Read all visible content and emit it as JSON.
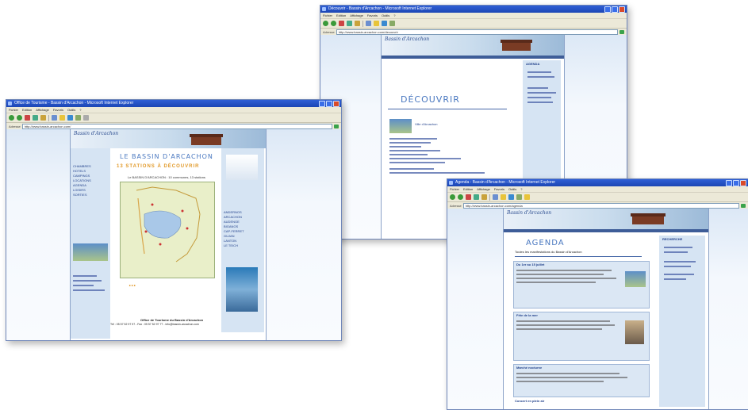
{
  "window_left": {
    "title": "Office de Tourisme - Bassin d'Arcachon - Microsoft Internet Explorer",
    "menu": [
      "Fichier",
      "Edition",
      "Affichage",
      "Favoris",
      "Outils",
      "?"
    ],
    "address": "http://www.bassin-arcachon.com/",
    "site_logo": "Bassin d'Arcachon",
    "headline": "LE BASSIN D'ARCACHON",
    "subheadline": "13 STATIONS À DÉCOUVRIR",
    "map_caption": "Le BASSIN D'ARCACHON : 10 communes, 13 stations",
    "sidebar_links": [
      "CHAMBRES",
      "HOTELS",
      "CAMPINGS",
      "LOCATIONS",
      "AGENDA",
      "LOISIRS",
      "SORTIES"
    ],
    "right_links": [
      "ANDERNOS",
      "ARCACHON",
      "AUDENGE",
      "BIGANOS",
      "CAP-FERRET",
      "GUJAN",
      "LANTON",
      "LE TEICH"
    ],
    "footer_line1": "Office de Tourisme du Bassin d'Arcachon",
    "footer_line2": "Tél : 05 57 52 97 97 - Fax : 05 57 52 97 77 - info@bassin-arcachon.com"
  },
  "window_top": {
    "title": "Découvrir - Bassin d'Arcachon - Microsoft Internet Explorer",
    "menu": [
      "Fichier",
      "Edition",
      "Affichage",
      "Favoris",
      "Outils",
      "?"
    ],
    "address": "http://www.bassin-arcachon.com/decouvrir",
    "site_logo": "Bassin d'Arcachon",
    "heading": "DÉCOUVRIR",
    "item_label": "Ville d'Arcachon",
    "sidebar_title": "AGENDA"
  },
  "window_right": {
    "title": "Agenda - Bassin d'Arcachon - Microsoft Internet Explorer",
    "menu": [
      "Fichier",
      "Edition",
      "Affichage",
      "Favoris",
      "Outils",
      "?"
    ],
    "address": "http://www.bassin-arcachon.com/agenda",
    "site_logo": "Bassin d'Arcachon",
    "heading": "AGENDA",
    "subheading": "Toutes les manifestations du Bassin d'Arcachon",
    "sidebar_title": "RECHERCHE",
    "events": [
      "Du 1er au 15 juillet",
      "Fête de la mer",
      "Marché nocturne",
      "Concert en plein air"
    ]
  }
}
